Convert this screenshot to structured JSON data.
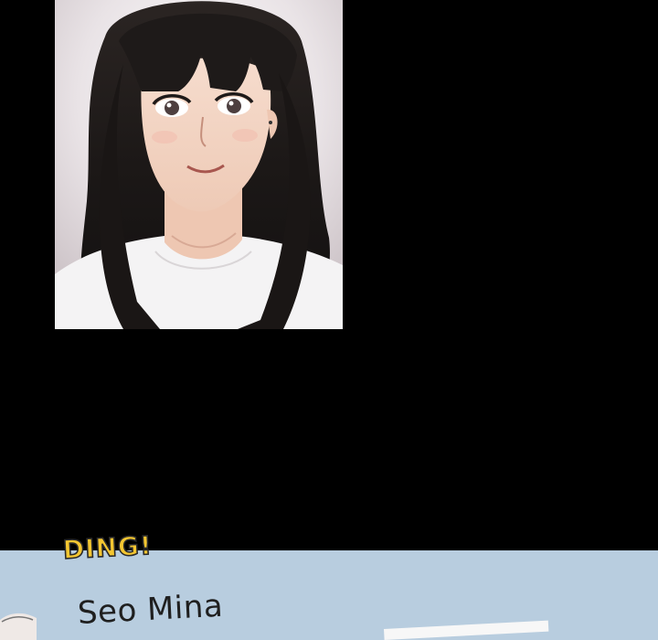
{
  "panel_top": {
    "image_name": "illustration-woman-portrait"
  },
  "phone_screen": {
    "sound_effect": "DING!",
    "caller_name": "Seo Mina"
  },
  "colors": {
    "background": "#000000",
    "panel_blue": "#b8cddf",
    "sfx_yellow": "#f5c731",
    "name_text": "#1f1f1f"
  }
}
